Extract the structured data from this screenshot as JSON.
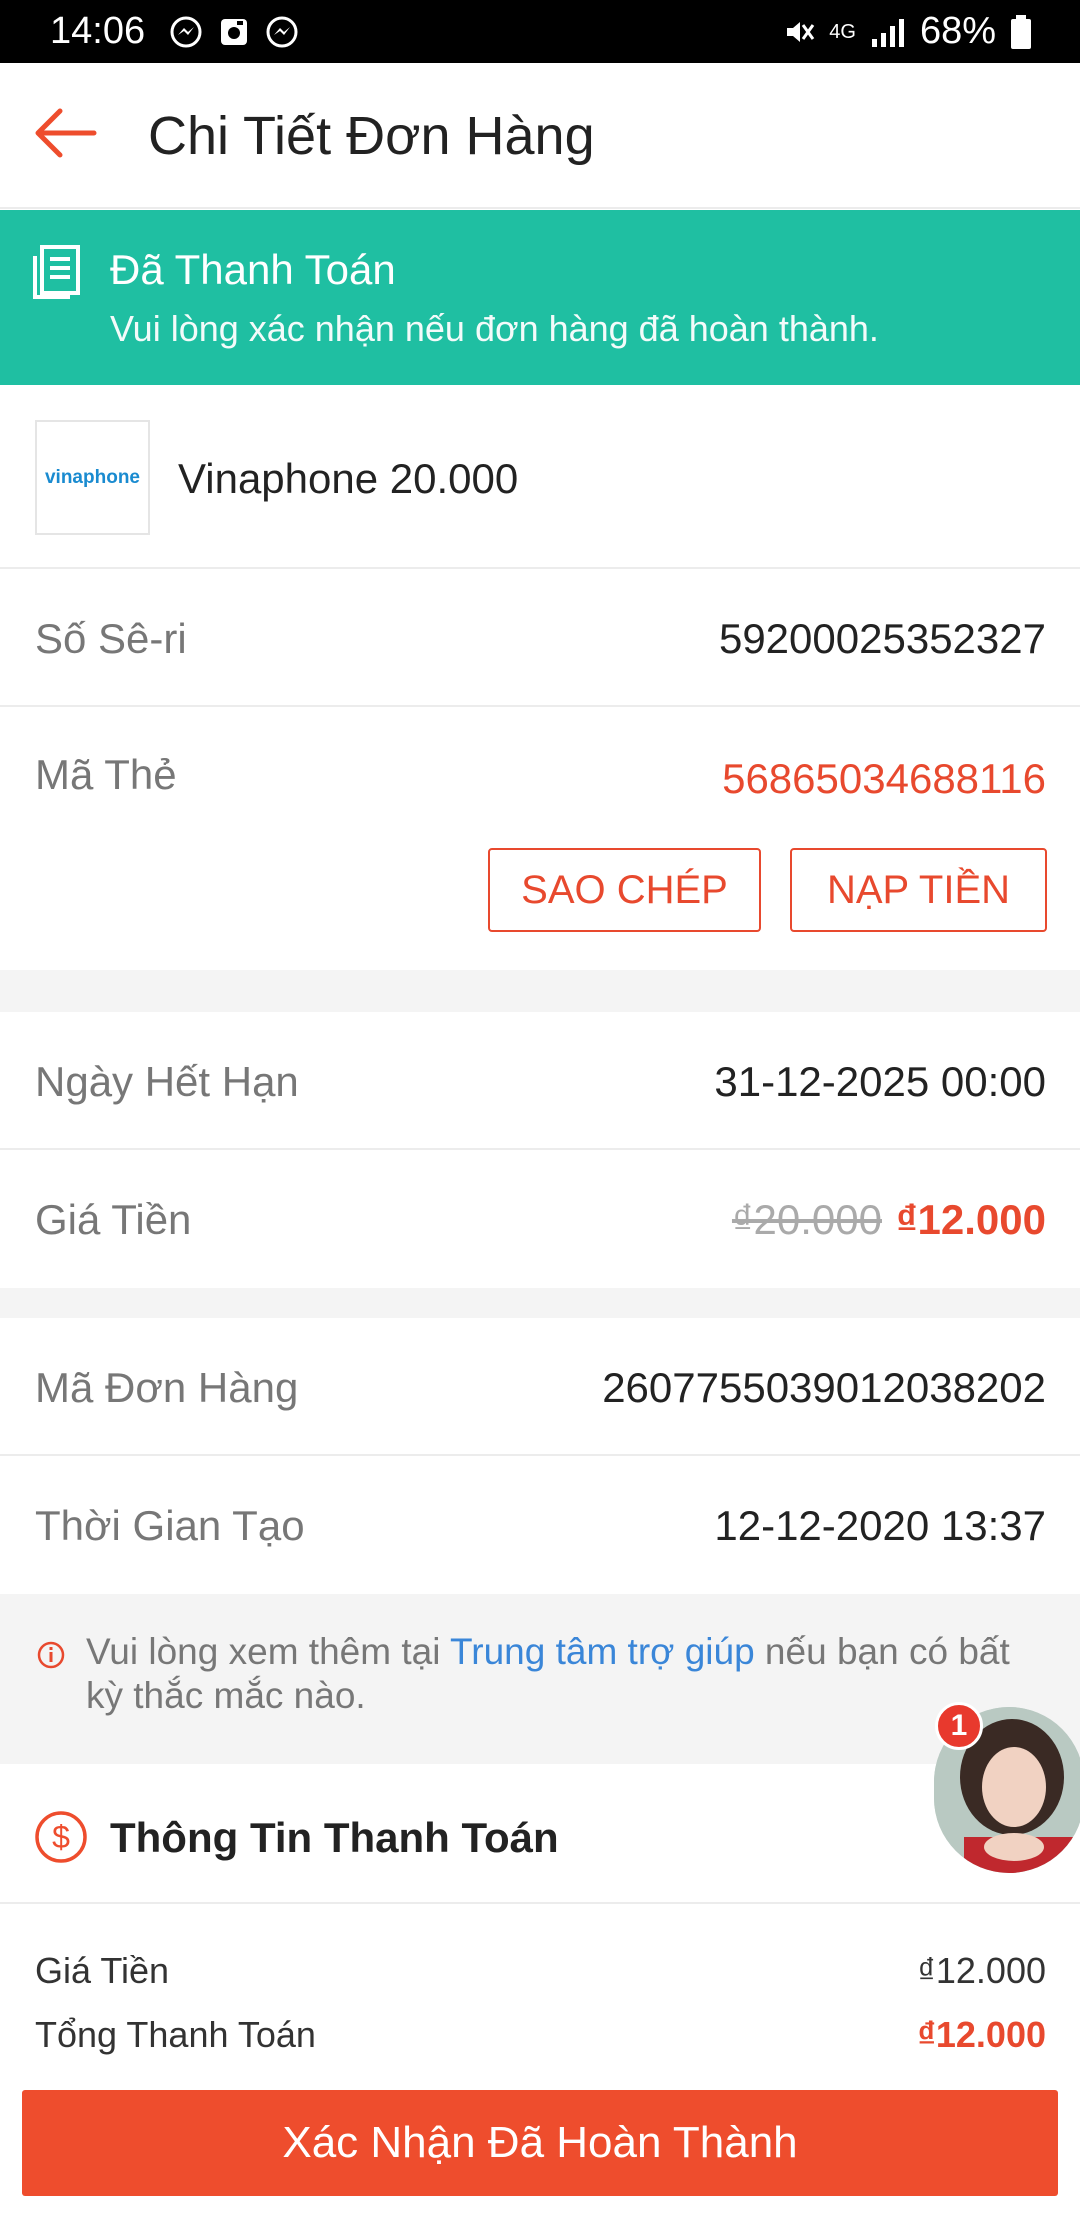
{
  "status_bar": {
    "time": "14:06",
    "battery": "68%",
    "network": "4G"
  },
  "header": {
    "title": "Chi Tiết Đơn Hàng"
  },
  "banner": {
    "title": "Đã Thanh Toán",
    "subtitle": "Vui lòng xác nhận nếu đơn hàng đã hoàn thành."
  },
  "product": {
    "logo_text": "vinaphone",
    "name": "Vinaphone 20.000"
  },
  "details": {
    "serial_label": "Số Sê-ri",
    "serial_value": "59200025352327",
    "card_code_label": "Mã Thẻ",
    "card_code_value": "56865034688116",
    "copy_button": "SAO CHÉP",
    "topup_button": "NẠP TIỀN",
    "expiry_label": "Ngày Hết Hạn",
    "expiry_value": "31-12-2025 00:00",
    "price_label": "Giá Tiền",
    "price_old": "₫20.000",
    "price_new": "₫12.000",
    "order_id_label": "Mã Đơn Hàng",
    "order_id_value": "2607755039012038202",
    "created_label": "Thời Gian Tạo",
    "created_value": "12-12-2020 13:37"
  },
  "info": {
    "text_before": "Vui lòng xem thêm tại ",
    "link": "Trung tâm trợ giúp",
    "text_after": " nếu bạn có bất kỳ thắc mắc nào."
  },
  "payment": {
    "title": "Thông Tin Thanh Toán",
    "price_label": "Giá Tiền",
    "price_value": "₫12.000",
    "total_label": "Tổng Thanh Toán",
    "total_value": "₫12.000"
  },
  "confirm_button": "Xác Nhận Đã Hoàn Thành",
  "chat": {
    "badge_count": "1"
  },
  "colors": {
    "accent": "#ee4d2d",
    "banner": "#1fbfa2",
    "link": "#3a86d8"
  }
}
